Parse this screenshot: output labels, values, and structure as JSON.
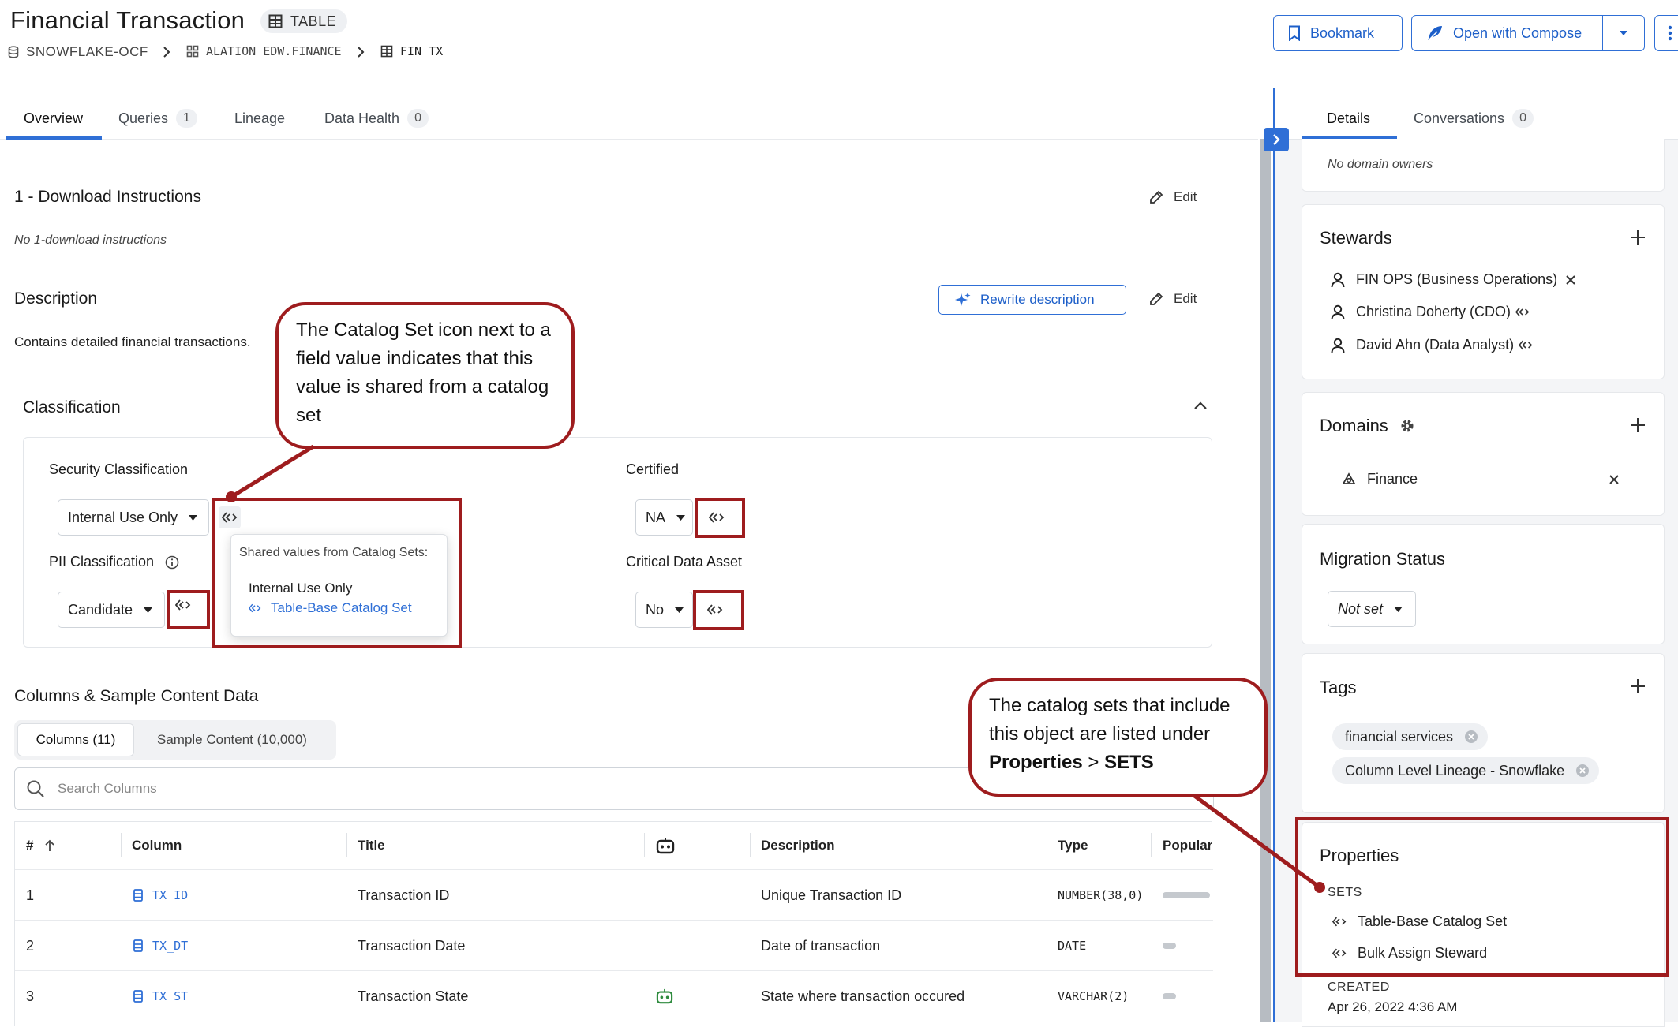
{
  "header": {
    "title": "Financial Transaction",
    "type_badge": "TABLE",
    "breadcrumb": [
      {
        "label": "SNOWFLAKE-OCF"
      },
      {
        "label": "ALATION_EDW.FINANCE"
      },
      {
        "label": "FIN_TX"
      }
    ],
    "bookmark_label": "Bookmark",
    "open_compose_label": "Open with Compose"
  },
  "tabs": [
    {
      "label": "Overview",
      "count": null,
      "active": true
    },
    {
      "label": "Queries",
      "count": "1"
    },
    {
      "label": "Lineage",
      "count": null
    },
    {
      "label": "Data Health",
      "count": "0"
    }
  ],
  "download": {
    "heading": "1 - Download Instructions",
    "empty": "No 1-download instructions",
    "edit_label": "Edit"
  },
  "description": {
    "heading": "Description",
    "text": "Contains detailed financial transactions.",
    "rewrite_label": "Rewrite description",
    "edit_label": "Edit"
  },
  "classification": {
    "heading": "Classification",
    "security_label": "Security Classification",
    "security_value": "Internal Use Only",
    "pii_label": "PII Classification",
    "pii_value": "Candidate",
    "certified_label": "Certified",
    "certified_value": "NA",
    "critical_label": "Critical Data Asset",
    "critical_value": "No"
  },
  "popup": {
    "title": "Shared values from Catalog Sets:",
    "value": "Internal Use Only",
    "set_link": "Table-Base Catalog Set"
  },
  "callouts": {
    "catalog_set_icon": "The Catalog Set icon next to a field value indicates that this value is shared from a catalog set",
    "sets_line1": "The catalog sets that include this object are listed under",
    "sets_bold1": "Properties",
    "sets_sep": " > ",
    "sets_bold2": "SETS"
  },
  "columns_section": {
    "heading": "Columns & Sample Content Data",
    "tab_columns": "Columns (11)",
    "tab_sample": "Sample Content (10,000)",
    "search_placeholder": "Search Columns",
    "headers": {
      "num": "#",
      "column": "Column",
      "title": "Title",
      "description": "Description",
      "type": "Type",
      "popularity": "Popular"
    },
    "rows": [
      {
        "num": "1",
        "column": "TX_ID",
        "title": "Transaction ID",
        "bot": false,
        "description": "Unique Transaction ID",
        "type": "NUMBER(38,0)",
        "popularity": 1.0
      },
      {
        "num": "2",
        "column": "TX_DT",
        "title": "Transaction Date",
        "bot": false,
        "description": "Date of transaction",
        "type": "DATE",
        "popularity": 0.28
      },
      {
        "num": "3",
        "column": "TX_ST",
        "title": "Transaction State",
        "bot": true,
        "description": "State where transaction occured",
        "type": "VARCHAR(2)",
        "popularity": 0.28
      }
    ]
  },
  "right_panel": {
    "tabs": [
      {
        "label": "Details",
        "count": null,
        "active": true
      },
      {
        "label": "Conversations",
        "count": "0"
      }
    ],
    "domain_owners_empty": "No domain owners",
    "stewards": {
      "heading": "Stewards",
      "items": [
        {
          "name": "FIN OPS (Business Operations)",
          "action": "remove"
        },
        {
          "name": "Christina Doherty (CDO)",
          "action": "catalog-set"
        },
        {
          "name": "David Ahn (Data Analyst)",
          "action": "catalog-set"
        }
      ]
    },
    "domains": {
      "heading": "Domains",
      "items": [
        "Finance"
      ]
    },
    "migration": {
      "heading": "Migration Status",
      "value": "Not set"
    },
    "tags": {
      "heading": "Tags",
      "items": [
        "financial services",
        "Column Level Lineage - Snowflake"
      ]
    },
    "properties": {
      "heading": "Properties",
      "sets_label": "SETS",
      "sets": [
        "Table-Base Catalog Set",
        "Bulk Assign Steward"
      ],
      "created_label": "CREATED",
      "created_value": "Apr 26, 2022 4:36 AM"
    }
  },
  "colors": {
    "accent": "#2f6fd6",
    "annotation_red": "#9e1c1e",
    "panel_bg": "#f4f5f7"
  }
}
